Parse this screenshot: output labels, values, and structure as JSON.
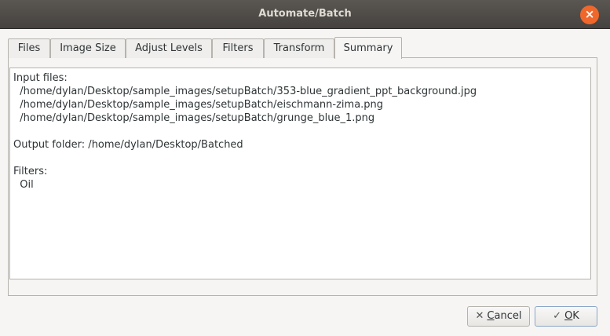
{
  "window": {
    "title": "Automate/Batch"
  },
  "tabs": [
    {
      "label": "Files"
    },
    {
      "label": "Image Size"
    },
    {
      "label": "Adjust Levels"
    },
    {
      "label": "Filters"
    },
    {
      "label": "Transform"
    },
    {
      "label": "Summary",
      "active": true
    }
  ],
  "summary": {
    "input_files_label": "Input files:",
    "input_files": [
      "  /home/dylan/Desktop/sample_images/setupBatch/353-blue_gradient_ppt_background.jpg",
      "  /home/dylan/Desktop/sample_images/setupBatch/eischmann-zima.png",
      "  /home/dylan/Desktop/sample_images/setupBatch/grunge_blue_1.png"
    ],
    "output_folder": "Output folder: /home/dylan/Desktop/Batched",
    "filters_label": "Filters:",
    "filters": [
      "  Oil"
    ]
  },
  "buttons": {
    "cancel_mnemonic": "C",
    "cancel_rest": "ancel",
    "ok_mnemonic": "O",
    "ok_rest": "K"
  },
  "icons": {
    "close": "close-icon",
    "cancel": "x-icon",
    "ok": "checkmark-icon"
  },
  "colors": {
    "titlebar": "#4b4845",
    "close_button": "#f0672b",
    "window_bg": "#f6f5f4"
  }
}
